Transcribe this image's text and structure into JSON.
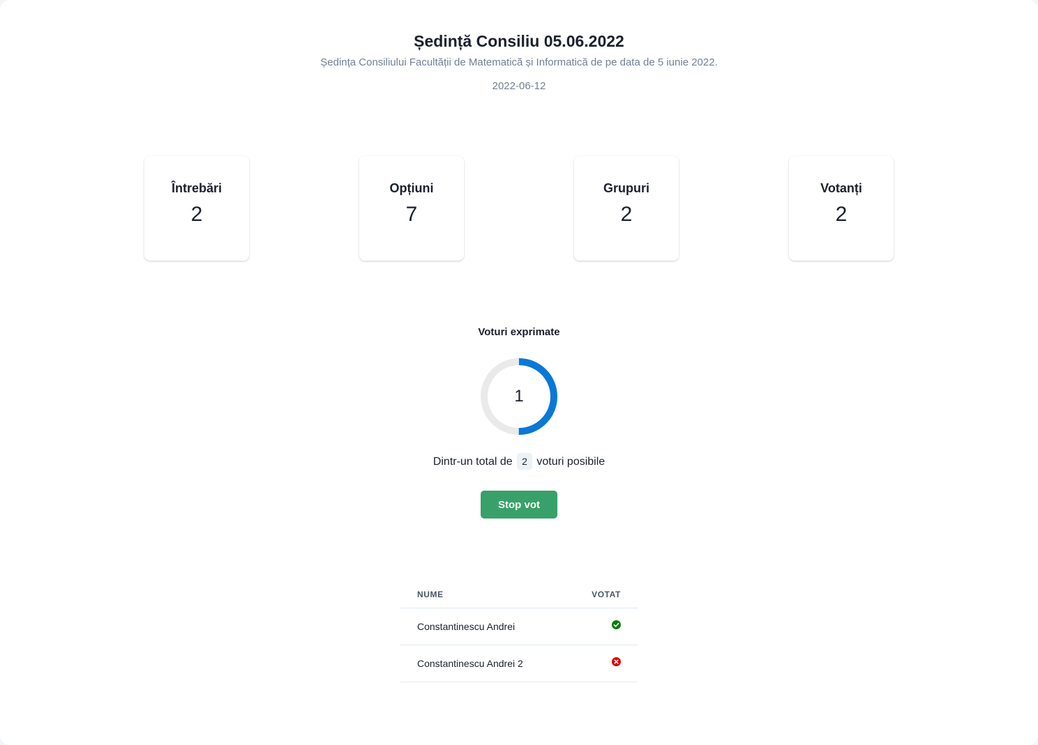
{
  "page": {
    "title": "Ședință Consiliu 05.06.2022",
    "description": "Ședința Consiliului Facultății de Matematică și Informatică de pe data de 5 iunie 2022.",
    "date": "2022-06-12"
  },
  "stats": [
    {
      "label": "Întrebări",
      "value": "2"
    },
    {
      "label": "Opțiuni",
      "value": "7"
    },
    {
      "label": "Grupuri",
      "value": "2"
    },
    {
      "label": "Votanți",
      "value": "2"
    }
  ],
  "votes": {
    "title": "Voturi exprimate",
    "cast": "1",
    "progress_fraction": 0.5,
    "total_prefix": "Dintr-un total de",
    "total": "2",
    "total_suffix": "voturi posibile",
    "stop_label": "Stop vot",
    "colors": {
      "progress": "#0a78d7",
      "track": "#eaeaea",
      "stop_button": "#38a169"
    }
  },
  "voters": {
    "columns": {
      "name": "NUME",
      "voted": "VOTAT"
    },
    "rows": [
      {
        "name": "Constantinescu Andrei",
        "voted": true,
        "icon": "check-circle-icon"
      },
      {
        "name": "Constantinescu Andrei 2",
        "voted": false,
        "icon": "x-circle-icon"
      }
    ],
    "colors": {
      "voted": "#0a7d0a",
      "not_voted": "#e00000"
    }
  }
}
